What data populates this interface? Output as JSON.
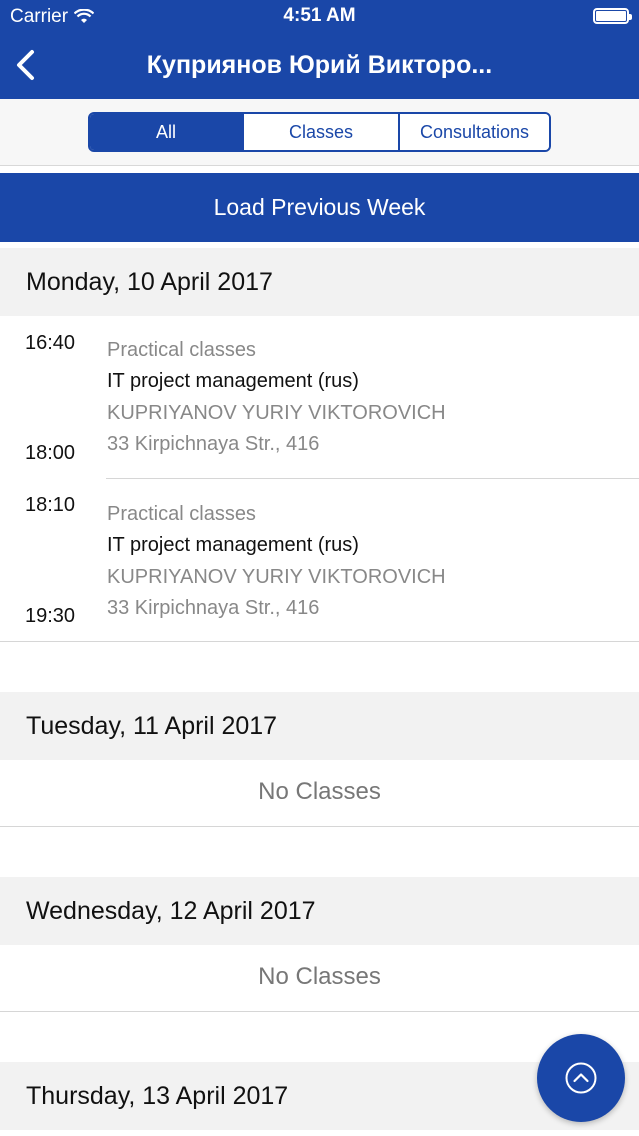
{
  "status_bar": {
    "carrier": "Carrier",
    "time": "4:51 AM",
    "wifi_icon": "wifi-icon",
    "battery_icon": "battery-icon"
  },
  "nav": {
    "back_icon": "chevron-left-icon",
    "title": "Куприянов Юрий Викторо..."
  },
  "filter": {
    "options": [
      "All",
      "Classes",
      "Consultations"
    ],
    "selected": "All"
  },
  "load_previous_label": "Load Previous Week",
  "days": [
    {
      "date": "Monday, 10 April 2017",
      "lessons": [
        {
          "start": "16:40",
          "end": "18:00",
          "type": "Practical classes",
          "subject": "IT project management (rus)",
          "teacher": "KUPRIYANOV YURIY VIKTOROVICH",
          "room": "33 Kirpichnaya Str., 416"
        },
        {
          "start": "18:10",
          "end": "19:30",
          "type": "Practical classes",
          "subject": "IT project management (rus)",
          "teacher": "KUPRIYANOV YURIY VIKTOROVICH",
          "room": "33 Kirpichnaya Str., 416"
        }
      ]
    },
    {
      "date": "Tuesday, 11 April 2017",
      "empty_text": "No Classes"
    },
    {
      "date": "Wednesday, 12 April 2017",
      "empty_text": "No Classes"
    },
    {
      "date": "Thursday, 13 April 2017"
    }
  ],
  "scroll_top_icon": "chevron-up-circle-icon",
  "colors": {
    "accent": "#1a47a8",
    "header_bg": "#f2f2f2",
    "muted_text": "#888888"
  }
}
